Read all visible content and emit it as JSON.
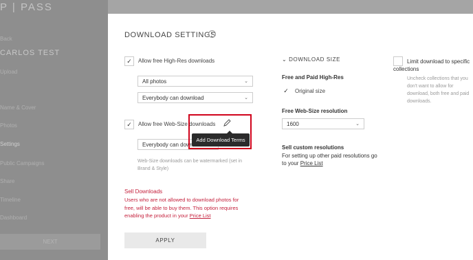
{
  "sidebar": {
    "logo": "P | PASS",
    "items_top": [
      "Back"
    ],
    "user_name": "CARLOS TEST",
    "user_sub": "Upload",
    "items": [
      "Name & Cover",
      "Photos",
      "Settings",
      "Public Campaigns",
      "Share",
      "Timeline",
      "Dashboard"
    ],
    "button": "NEXT"
  },
  "panel": {
    "title": "DOWNLOAD SETTINGS",
    "high_res": {
      "checkbox_label": "Allow free High-Res downloads",
      "checked": true,
      "select_photos": "All photos",
      "select_who": "Everybody can download"
    },
    "web_size": {
      "checkbox_label": "Allow free Web-Size downloads",
      "checked": true,
      "select_who": "Everybody can download",
      "hint": "Web-Size downloads can be watermarked (set in Brand & Style)"
    },
    "tooltip": "Add Download Terms",
    "sell": {
      "title": "Sell Downloads",
      "text": "Users who are not allowed to download photos for free, will be able to buy them. This option requires enabling the product in your",
      "link": "Price List"
    },
    "apply_label": "APPLY",
    "download_size": {
      "heading": "DOWNLOAD SIZE",
      "free_paid_label": "Free and Paid High-Res",
      "original_label": "Original size",
      "original_checked": true,
      "web_res_label": "Free Web-Size resolution",
      "web_res_value": "1600",
      "custom_title": "Sell custom resolutions",
      "custom_text": "For setting up other paid resolutions go to your",
      "custom_link": "Price List"
    },
    "limit": {
      "label": "Limit download to specific collections",
      "hint": "Uncheck collections that you don't want to allow for download, both free and paid downloads."
    }
  },
  "colors": {
    "accent_red": "#c41e3a",
    "highlight_red": "#d0021b",
    "tooltip_bg": "#2b2b2b"
  }
}
